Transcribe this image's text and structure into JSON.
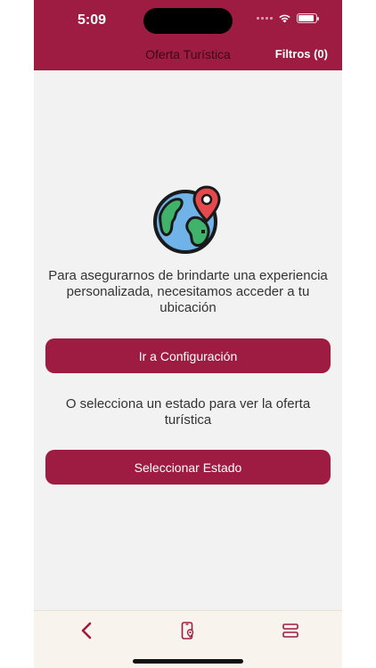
{
  "status_bar": {
    "time": "5:09"
  },
  "header": {
    "title": "Oferta Turística",
    "filters_label": "Filtros (0)"
  },
  "content": {
    "icon": "globe-location-pin-icon",
    "location_message": "Para asegurarnos de brindarte una experiencia personalizada, necesitamos acceder a tu ubicación",
    "config_button": "Ir a Configuración",
    "alt_message": "O selecciona un estado para ver la oferta turística",
    "state_button": "Seleccionar Estado"
  },
  "tab_bar": {
    "items": [
      {
        "icon": "chevron-left-icon"
      },
      {
        "icon": "phone-location-icon"
      },
      {
        "icon": "menu-toggle-icon"
      }
    ]
  },
  "colors": {
    "primary": "#9e1c41",
    "background": "#f2f2f2",
    "tabbar": "#f8f3ec"
  }
}
